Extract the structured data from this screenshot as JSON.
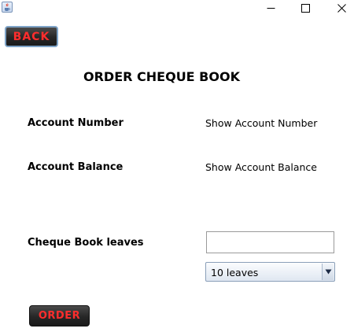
{
  "window": {
    "icon": "java-cup-icon",
    "controls": {
      "minimize_icon": "minimize-icon",
      "maximize_icon": "maximize-icon",
      "close_icon": "close-icon"
    }
  },
  "back_button": {
    "label": "BACK",
    "color": "#ff2d2d"
  },
  "page_title": "ORDER CHEQUE BOOK",
  "account_number": {
    "label": "Account Number",
    "value": "Show Account Number"
  },
  "account_balance": {
    "label": "Account Balance",
    "value": "Show Account Balance"
  },
  "cheque_leaves": {
    "label": "Cheque Book leaves",
    "input_value": "",
    "selected_option": "10 leaves"
  },
  "order_button": {
    "label": "ORDER",
    "color": "#ff2d2d"
  }
}
